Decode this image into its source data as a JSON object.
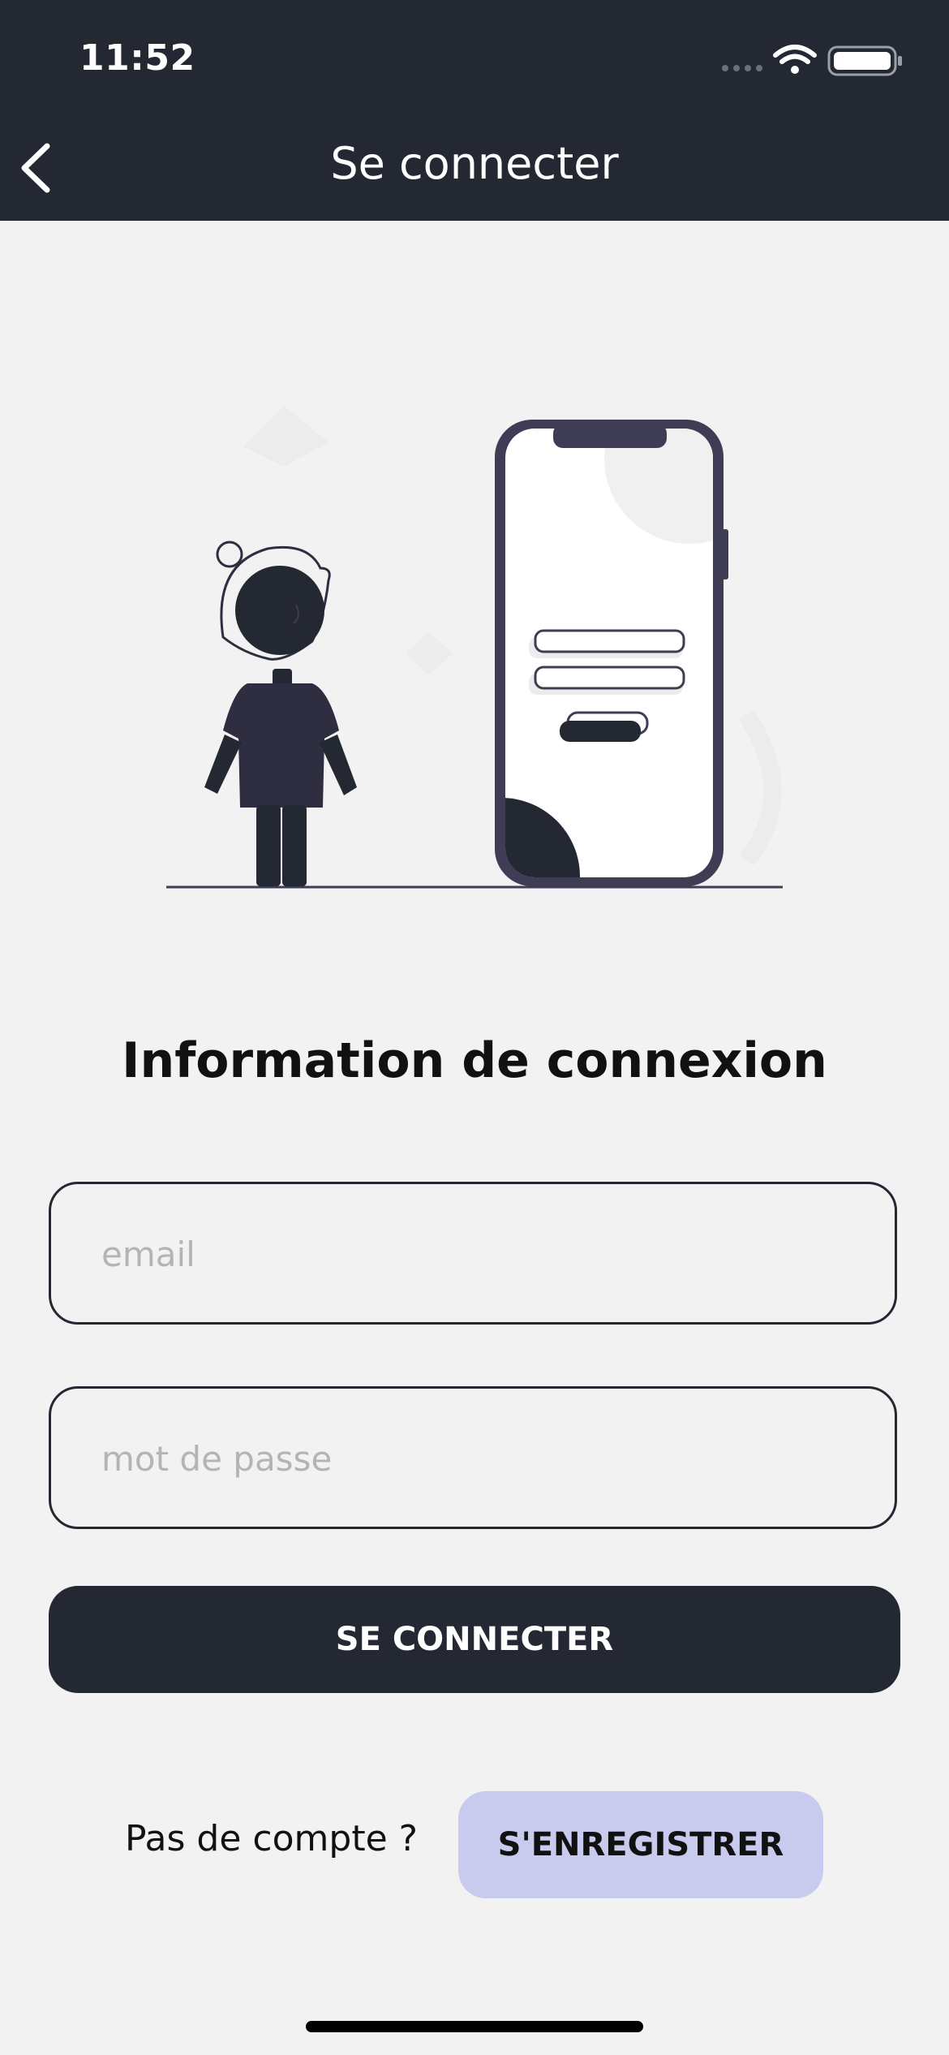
{
  "status_bar": {
    "time": "11:52"
  },
  "nav": {
    "title": "Se connecter"
  },
  "form": {
    "heading": "Information de connexion",
    "email_placeholder": "email",
    "password_placeholder": "mot de passe",
    "login_label": "SE CONNECTER"
  },
  "footer": {
    "no_account_text": "Pas de compte ?",
    "register_label": "S'ENREGISTRER"
  },
  "colors": {
    "header_bg": "#232833",
    "page_bg": "#f2f2f2",
    "primary_button": "#232833",
    "register_button": "#c9cbee",
    "illustration_accent": "#3f3d56"
  }
}
